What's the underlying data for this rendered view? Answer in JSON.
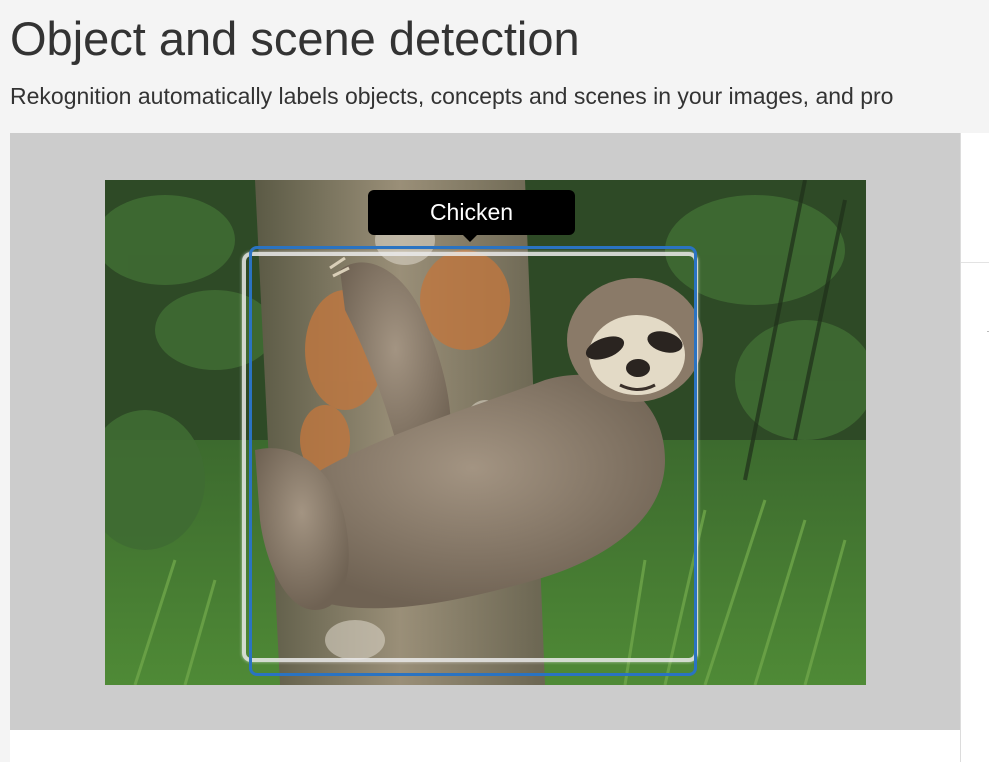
{
  "header": {
    "title": "Object and scene detection",
    "subtitle": "Rekognition automatically labels objects, concepts and scenes in your images, and pro"
  },
  "demo": {
    "detected_label": "Chicken",
    "image_subject": "sloth-on-tree-photo"
  },
  "colors": {
    "page_background": "#f4f4f4",
    "demo_panel_background": "#cccccc",
    "bounding_box_blue": "#2a73c2",
    "tooltip_background": "#000000",
    "tooltip_text": "#ffffff"
  }
}
